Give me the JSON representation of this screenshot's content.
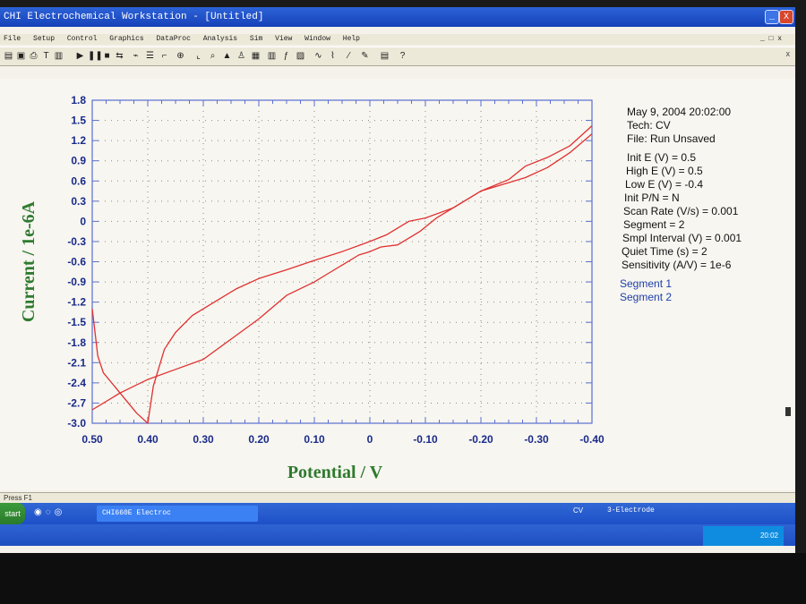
{
  "window": {
    "title": "CHI Electrochemical Workstation - [Untitled]",
    "minimize_label": "_",
    "close_label": "X"
  },
  "menu": {
    "items": [
      "File",
      "Setup",
      "Control",
      "Graphics",
      "DataProc",
      "Analysis",
      "Sim",
      "View",
      "Window",
      "Help"
    ],
    "mdi_controls": "_ □ x"
  },
  "toolbar": {
    "icons": [
      "open-icon",
      "save-icon",
      "print-icon",
      "run-icon",
      "pause-icon",
      "stop-icon",
      "reverse-icon",
      "zoom-icon",
      "graph-icon",
      "data-icon",
      "help-icon"
    ]
  },
  "chart_data": {
    "type": "line",
    "xlabel": "Potential / V",
    "ylabel": "Current / 1e-6A",
    "xlim": [
      0.5,
      -0.4
    ],
    "ylim": [
      -3.0,
      1.8
    ],
    "x_ticks": [
      "0.50",
      "0.40",
      "0.30",
      "0.20",
      "0.10",
      "0",
      "-0.10",
      "-0.20",
      "-0.30",
      "-0.40"
    ],
    "y_ticks": [
      "1.8",
      "1.5",
      "1.2",
      "0.9",
      "0.6",
      "0.3",
      "0",
      "-0.3",
      "-0.6",
      "-0.9",
      "-1.2",
      "-1.5",
      "-1.8",
      "-2.1",
      "-2.4",
      "-2.7",
      "-3.0"
    ],
    "grid": true,
    "series": [
      {
        "name": "Segment 1",
        "color": "#e03030",
        "points": [
          [
            0.5,
            -1.3
          ],
          [
            0.49,
            -2.0
          ],
          [
            0.48,
            -2.25
          ],
          [
            0.46,
            -2.45
          ],
          [
            0.44,
            -2.65
          ],
          [
            0.42,
            -2.85
          ],
          [
            0.4,
            -3.0
          ],
          [
            0.39,
            -2.45
          ],
          [
            0.37,
            -1.9
          ],
          [
            0.35,
            -1.65
          ],
          [
            0.32,
            -1.4
          ],
          [
            0.28,
            -1.2
          ],
          [
            0.24,
            -1.0
          ],
          [
            0.2,
            -0.85
          ],
          [
            0.15,
            -0.72
          ],
          [
            0.1,
            -0.58
          ],
          [
            0.05,
            -0.45
          ],
          [
            0.0,
            -0.3
          ],
          [
            -0.03,
            -0.2
          ],
          [
            -0.07,
            0.0
          ],
          [
            -0.1,
            0.05
          ],
          [
            -0.15,
            0.2
          ],
          [
            -0.2,
            0.45
          ],
          [
            -0.25,
            0.62
          ],
          [
            -0.28,
            0.82
          ],
          [
            -0.32,
            0.95
          ],
          [
            -0.36,
            1.12
          ],
          [
            -0.4,
            1.42
          ]
        ]
      },
      {
        "name": "Segment 2",
        "color": "#e03030",
        "points": [
          [
            -0.4,
            1.3
          ],
          [
            -0.36,
            1.02
          ],
          [
            -0.32,
            0.8
          ],
          [
            -0.28,
            0.65
          ],
          [
            -0.24,
            0.55
          ],
          [
            -0.2,
            0.45
          ],
          [
            -0.16,
            0.25
          ],
          [
            -0.12,
            0.05
          ],
          [
            -0.09,
            -0.15
          ],
          [
            -0.05,
            -0.35
          ],
          [
            -0.02,
            -0.38
          ],
          [
            0.0,
            -0.45
          ],
          [
            0.02,
            -0.5
          ],
          [
            0.05,
            -0.65
          ],
          [
            0.08,
            -0.8
          ],
          [
            0.1,
            -0.9
          ],
          [
            0.15,
            -1.1
          ],
          [
            0.2,
            -1.45
          ],
          [
            0.25,
            -1.75
          ],
          [
            0.3,
            -2.05
          ],
          [
            0.35,
            -2.2
          ],
          [
            0.4,
            -2.35
          ],
          [
            0.45,
            -2.55
          ],
          [
            0.5,
            -2.8
          ]
        ]
      }
    ]
  },
  "params": {
    "lines": [
      "May 9, 2004   20:02:00",
      "Tech: CV",
      "File: Run Unsaved",
      "Init E (V) = 0.5",
      "High E (V) = 0.5",
      "Low E (V) = -0.4",
      "Init P/N = N",
      "Scan Rate (V/s) = 0.001",
      "Segment = 2",
      "Smpl Interval (V) = 0.001",
      "Quiet Time (s) = 2",
      "Sensitivity (A/V) = 1e-6"
    ],
    "segments": [
      "Segment 1",
      "Segment 2"
    ]
  },
  "status": {
    "hint": "Press F1",
    "tech": "CV",
    "electrode": "3-Electrode"
  },
  "taskbar": {
    "start": "start",
    "task_label": "CHI660E Electroc",
    "clock": "20:02"
  }
}
